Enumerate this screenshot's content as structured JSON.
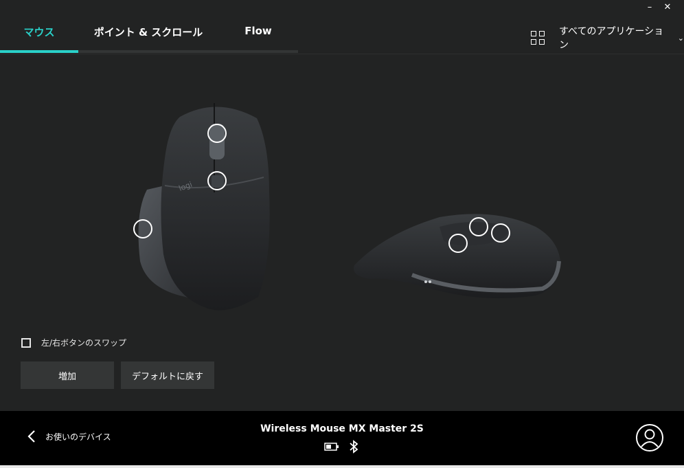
{
  "window": {
    "minimize_glyph": "–",
    "close_glyph": "✕"
  },
  "tabs": [
    {
      "label": "マウス",
      "active": true
    },
    {
      "label": "ポイント & スクロール",
      "active": false
    },
    {
      "label": "Flow",
      "active": false
    }
  ],
  "app_selector": {
    "icon": "grid-icon",
    "label": "すべてのアプリケーション",
    "chevron": "⌄"
  },
  "options": {
    "swap_label": "左/右ボタンのスワップ",
    "swap_checked": false
  },
  "buttons": {
    "add": "増加",
    "restore_default": "デフォルトに戻す"
  },
  "footer": {
    "back_label": "お使いのデバイス",
    "device_name": "Wireless Mouse MX Master 2S",
    "battery_icon": "battery-icon",
    "connection_icon": "bluetooth-icon",
    "account_icon": "account-icon"
  },
  "colors": {
    "accent": "#2ad1c9",
    "background": "#222323",
    "footer": "#000000",
    "button": "#343636"
  }
}
